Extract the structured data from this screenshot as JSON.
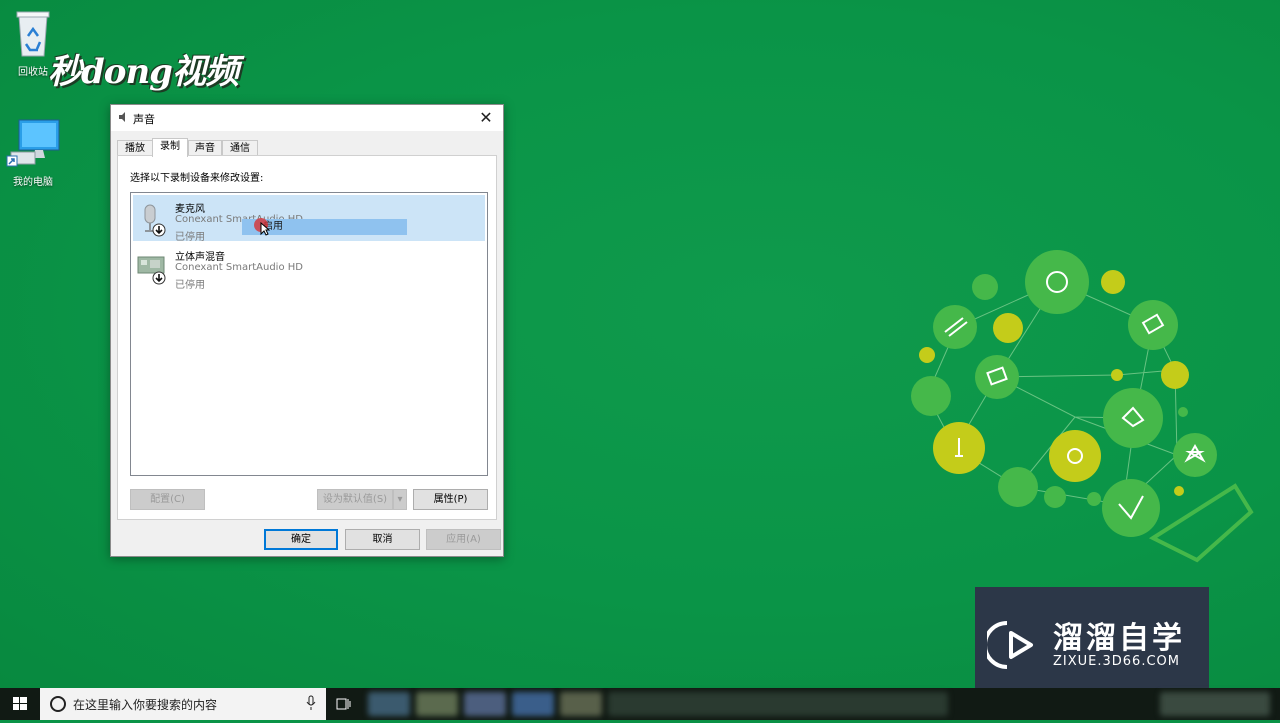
{
  "desktop": {
    "recycle_bin_label": "回收站",
    "my_computer_label": "我的电脑",
    "logo_text": "秒dong视频"
  },
  "dialog": {
    "title": "声音",
    "tabs": [
      {
        "label": "播放",
        "active": false
      },
      {
        "label": "录制",
        "active": true
      },
      {
        "label": "声音",
        "active": false
      },
      {
        "label": "通信",
        "active": false
      }
    ],
    "instruction": "选择以下录制设备来修改设置:",
    "devices": [
      {
        "name": "麦克风",
        "driver": "Conexant SmartAudio HD",
        "status": "已停用",
        "selected": true,
        "icon": "microphone-icon"
      },
      {
        "name": "立体声混音",
        "driver": "Conexant SmartAudio HD",
        "status": "已停用",
        "selected": false,
        "icon": "sound-card-icon"
      }
    ],
    "context_menu": {
      "item": "启用"
    },
    "buttons": {
      "configure": "配置(C)",
      "set_default": "设为默认值(S)",
      "properties": "属性(P)",
      "ok": "确定",
      "cancel": "取消",
      "apply": "应用(A)"
    }
  },
  "watermark": {
    "title": "溜溜自学",
    "url": "ZIXUE.3D66.COM"
  },
  "taskbar": {
    "search_placeholder": "在这里输入你要搜索的内容"
  },
  "colors": {
    "desktop": "#0a9447",
    "selection": "#cce4f7",
    "context_highlight": "#8fc2ef",
    "accent": "#0078d7",
    "watermark_bg": "#2c3748"
  }
}
